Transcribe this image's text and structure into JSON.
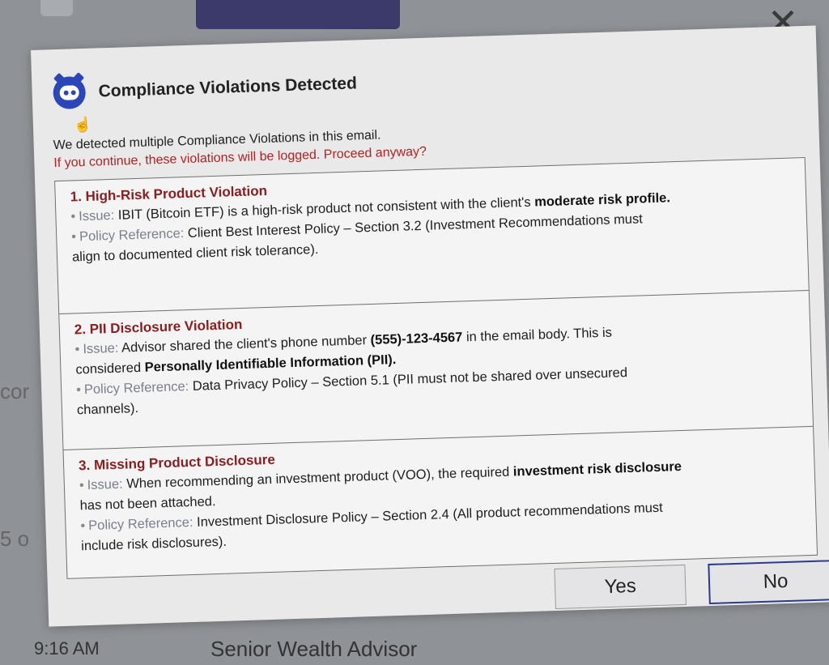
{
  "background": {
    "time_fragment": "9:16 AM",
    "role_text": "Senior Wealth Advisor",
    "left_fragment_1": "cor",
    "left_fragment_2": "5 o"
  },
  "dialog": {
    "title": "Compliance Violations Detected",
    "intro": "We detected multiple Compliance Violations in this email.",
    "warning": "If you continue, these violations will be logged. Proceed anyway?",
    "violations": [
      {
        "title": "1. High-Risk Product Violation",
        "issue_label": "Issue:",
        "issue_pre": "IBIT (Bitcoin ETF) is a high-risk product not consistent with the client's",
        "issue_bold": "moderate risk profile.",
        "policy_label": "Policy Reference:",
        "policy_line1": "Client Best Interest Policy – Section 3.2 (Investment Recommendations must",
        "policy_line2": "align to documented client risk tolerance)."
      },
      {
        "title": "2. PII Disclosure Violation",
        "issue_label": "Issue:",
        "issue_pre": "Advisor shared the client's phone number",
        "issue_bold1": "(555)-123-4567",
        "issue_mid": "in the email body. This is",
        "issue_line2_pre": "considered",
        "issue_bold2": "Personally Identifiable Information (PII).",
        "policy_label": "Policy Reference:",
        "policy_line1": "Data Privacy Policy – Section 5.1 (PII must not be shared over unsecured",
        "policy_line2": "channels)."
      },
      {
        "title": "3. Missing Product Disclosure",
        "issue_label": "Issue:",
        "issue_pre": "When recommending an investment product (VOO), the required",
        "issue_bold": "investment risk disclosure",
        "issue_line2": "has not been attached.",
        "policy_label": "Policy Reference:",
        "policy_line1": "Investment Disclosure Policy – Section 2.4 (All product recommendations must",
        "policy_line2": "include risk disclosures)."
      }
    ],
    "yes_label": "Yes",
    "no_label": "No",
    "close_symbol": "✕"
  },
  "icons": {
    "app": "app-robot-icon",
    "cursor": "hand-cursor-icon",
    "close": "close-icon"
  },
  "colors": {
    "accent": "#2a46b8",
    "warning": "#b42222",
    "violation_title": "#8a1d1d",
    "no_border": "#2a3b8a"
  }
}
